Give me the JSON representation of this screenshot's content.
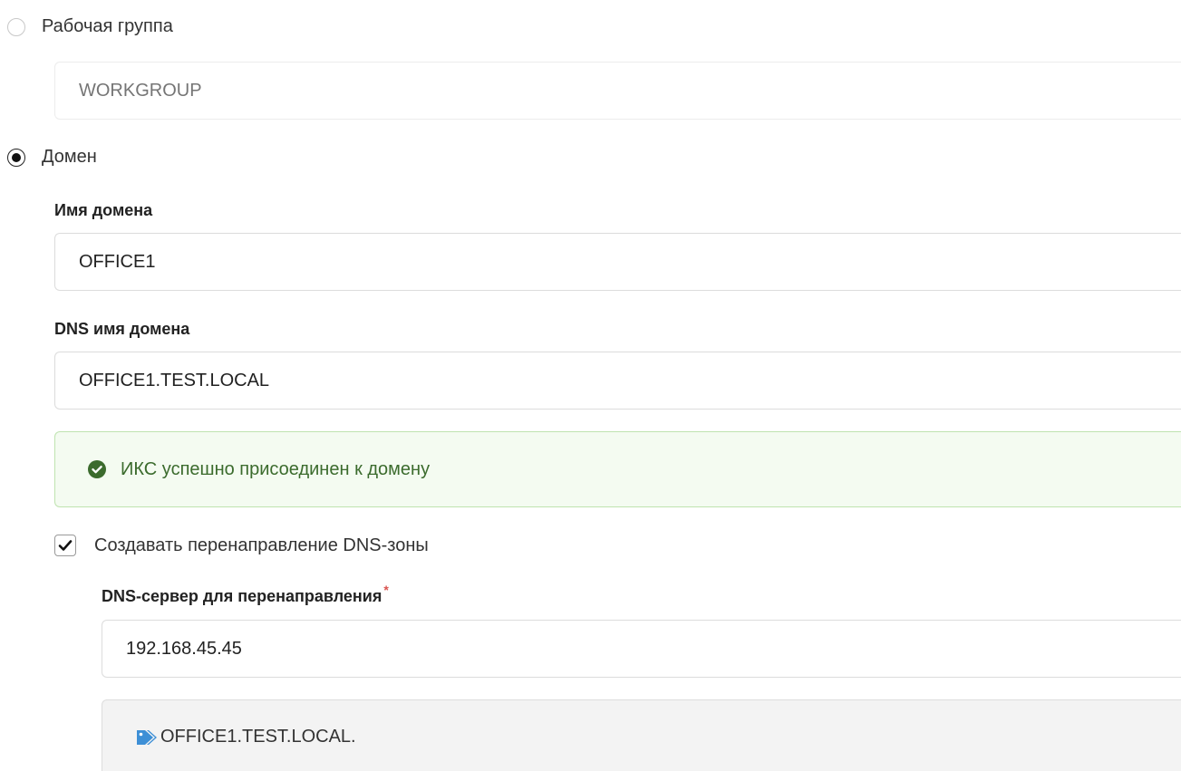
{
  "workgroup": {
    "radio_label": "Рабочая группа",
    "selected": false,
    "input_placeholder": "WORKGROUP",
    "input_value": ""
  },
  "domain": {
    "radio_label": "Домен",
    "selected": true,
    "name_label": "Имя домена",
    "name_value": "OFFICE1",
    "dns_name_label": "DNS имя домена",
    "dns_name_value": "OFFICE1.TEST.LOCAL"
  },
  "status": {
    "icon": "check-circle-icon",
    "message": "ИКС успешно присоединен к домену",
    "color": "#3b6b2d"
  },
  "dns_forward": {
    "checkbox_label": "Создавать перенаправление DNS-зоны",
    "checked": true,
    "server_label": "DNS-сервер для перенаправления",
    "required_mark": "*",
    "server_value": "192.168.45.45",
    "zone_icon": "tag-icon",
    "zone_tag": "OFFICE1.TEST.LOCAL."
  },
  "colors": {
    "accent_blue": "#3d8fd6",
    "success_bg": "#f4fbf1",
    "success_border": "#bfe3b0",
    "required": "#d9534f"
  }
}
